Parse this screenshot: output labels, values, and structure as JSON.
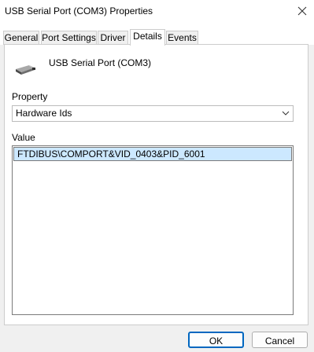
{
  "window": {
    "title": "USB Serial Port (COM3) Properties"
  },
  "tabs": [
    {
      "label": "General"
    },
    {
      "label": "Port Settings"
    },
    {
      "label": "Driver"
    },
    {
      "label": "Details"
    },
    {
      "label": "Events"
    }
  ],
  "active_tab": "Details",
  "device": {
    "name": "USB Serial Port (COM3)",
    "icon": "usb-device-icon"
  },
  "property": {
    "label": "Property",
    "selected": "Hardware Ids"
  },
  "value": {
    "label": "Value",
    "items": [
      "FTDIBUS\\COMPORT&VID_0403&PID_6001"
    ]
  },
  "buttons": {
    "ok": "OK",
    "cancel": "Cancel"
  }
}
